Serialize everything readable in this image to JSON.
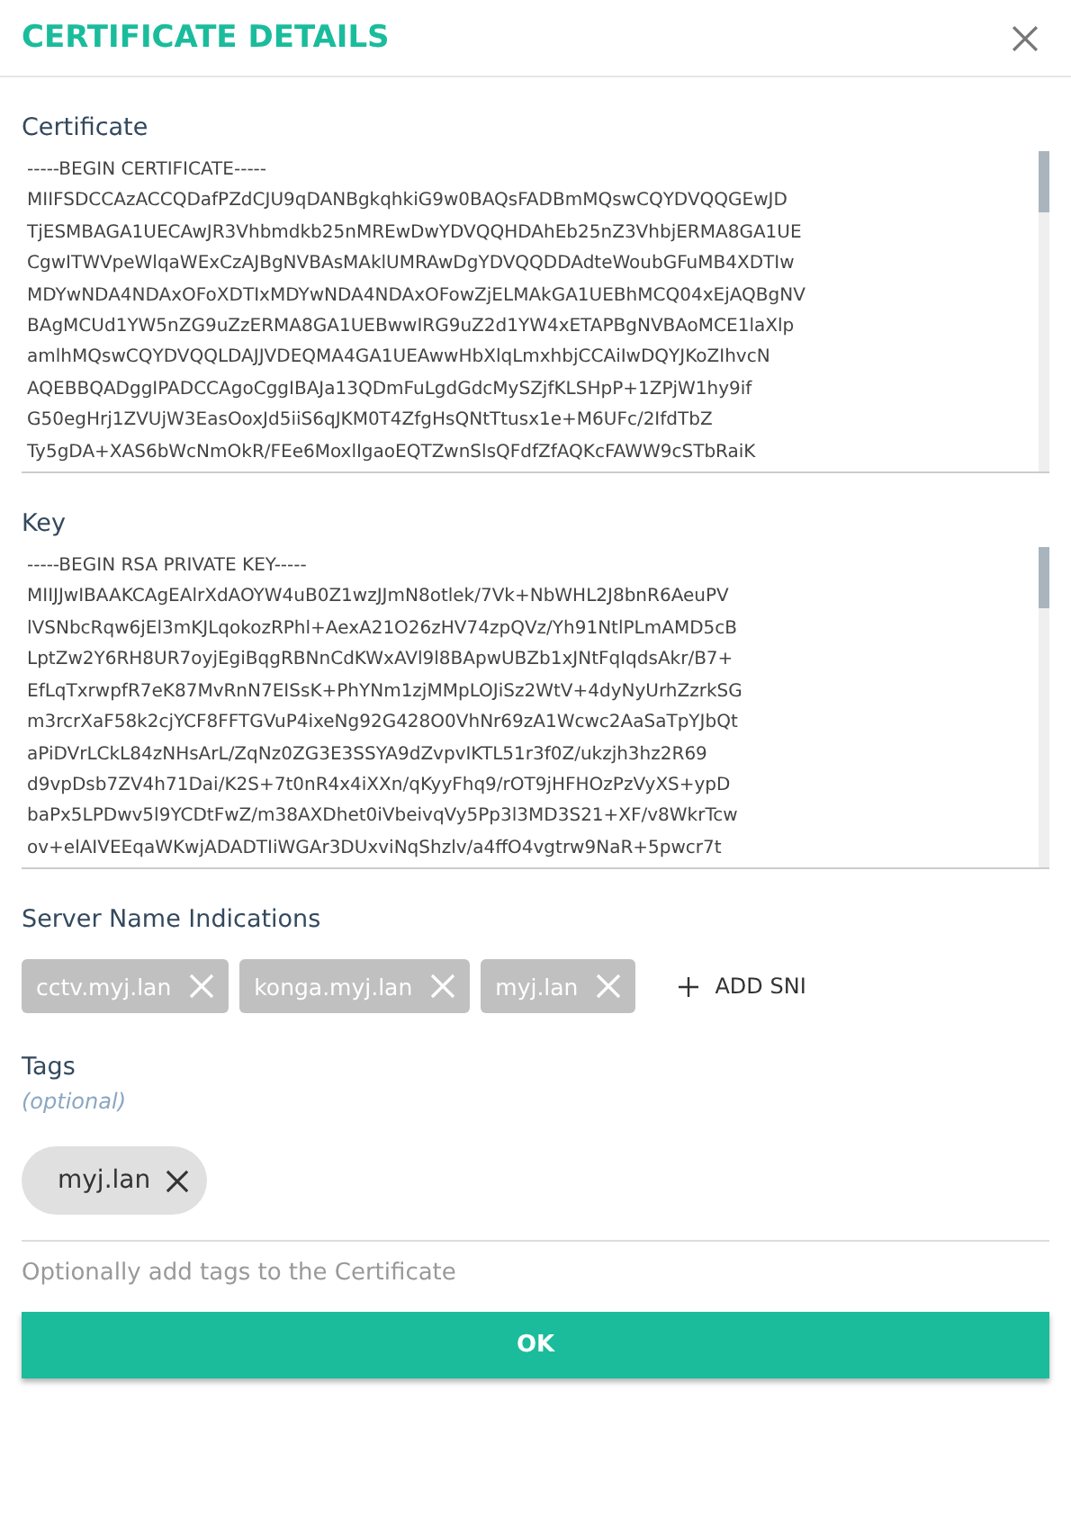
{
  "dialog": {
    "title": "CERTIFICATE DETAILS"
  },
  "certificate": {
    "label": "Certificate",
    "lines": [
      "-----BEGIN CERTIFICATE-----",
      "MIIFSDCCAzACCQDafPZdCJU9qDANBgkqhkiG9w0BAQsFADBmMQswCQYDVQQGEwJD",
      "TjESMBAGA1UECAwJR3Vhbmdkb25nMREwDwYDVQQHDAhEb25nZ3VhbjERMA8GA1UE",
      "CgwITWVpeWlqaWExCzAJBgNVBAsMAklUMRAwDgYDVQQDDAdteWoubGFuMB4XDTIw",
      "MDYwNDA4NDAxOFoXDTIxMDYwNDA4NDAxOFowZjELMAkGA1UEBhMCQ04xEjAQBgNV",
      "BAgMCUd1YW5nZG9uZzERMA8GA1UEBwwIRG9uZ2d1YW4xETAPBgNVBAoMCE1laXlp",
      "amlhMQswCQYDVQQLDAJJVDEQMA4GA1UEAwwHbXlqLmxhbjCCAiIwDQYJKoZIhvcN",
      "AQEBBQADggIPADCCAgoCggIBAJa13QDmFuLgdGdcMySZjfKLSHpP+1ZPjW1hy9if",
      "G50egHrj1ZVUjW3EasOoxJd5iiS6qJKM0T4ZfgHsQNtTtusx1e+M6UFc/2IfdTbZ",
      "Ty5gDA+XAS6bWcNmOkR/FEe6MoxlIgaoEQTZwnSlsQFdfZfAQKcFAWW9cSTbRaiK"
    ]
  },
  "key": {
    "label": "Key",
    "lines": [
      "-----BEGIN RSA PRIVATE KEY-----",
      "MIIJJwIBAAKCAgEAlrXdAOYW4uB0Z1wzJJmN8otlek/7Vk+NbWHL2J8bnR6AeuPV",
      "lVSNbcRqw6jEl3mKJLqokozRPhl+AexA21O26zHV74zpQVz/Yh91NtlPLmAMD5cB",
      "LptZw2Y6RH8UR7oyjEgiBqgRBNnCdKWxAVl9l8BApwUBZb1xJNtFqIqdsAkr/B7+",
      "EfLqTxrwpfR7eK87MvRnN7EISsK+PhYNm1zjMMpLOJiSz2WtV+4dyNyUrhZzrkSG",
      "m3rcrXaF58k2cjYCF8FFTGVuP4ixeNg92G428O0VhNr69zA1Wcwc2AaSaTpYJbQt",
      "aPiDVrLCkL84zNHsArL/ZqNz0ZG3E3SSYA9dZvpvIKTL51r3f0Z/ukzjh3hz2R69",
      "d9vpDsb7ZV4h71Dai/K2S+7t0nR4x4iXXn/qKyyFhq9/rOT9jHFHOzPzVyXS+ypD",
      "baPx5LPDwv5l9YCDtFwZ/m38AXDhet0iVbeivqVy5Pp3l3MD3S21+XF/v8WkrTcw",
      "ov+elAIVEEqaWKwjADADTIiWGAr3DUxviNqShzlv/a4ffO4vgtrw9NaR+5pwcr7t"
    ]
  },
  "sni": {
    "label": "Server Name Indications",
    "items": [
      "cctv.myj.lan",
      "konga.myj.lan",
      "myj.lan"
    ],
    "add_label": "ADD SNI"
  },
  "tags": {
    "label": "Tags",
    "hint": "(optional)",
    "items": [
      "myj.lan"
    ],
    "placeholder": "Optionally add tags to the Certificate"
  },
  "buttons": [
    "OK"
  ]
}
